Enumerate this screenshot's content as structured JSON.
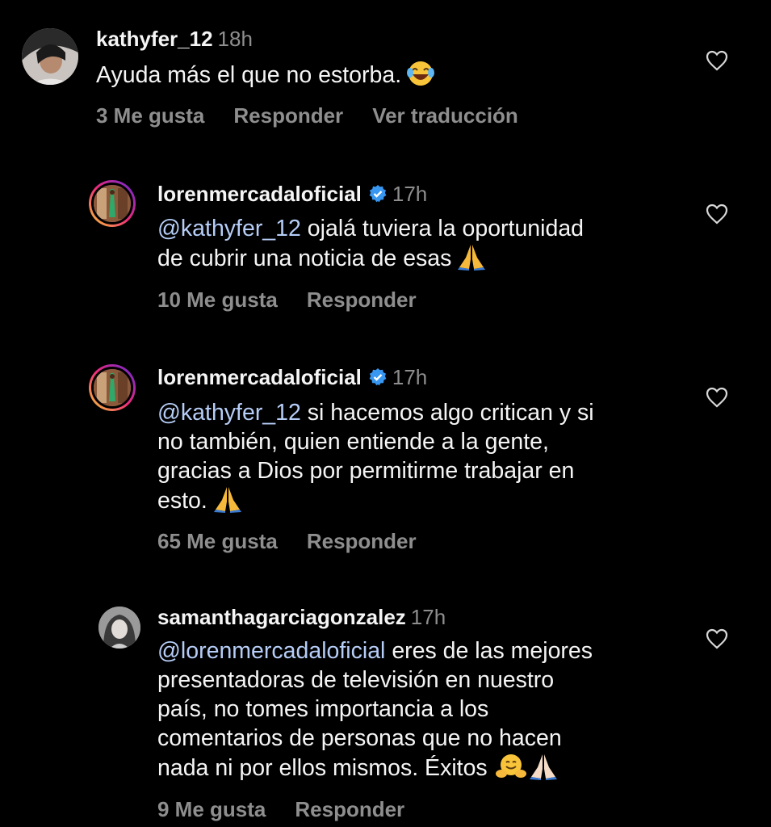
{
  "comments": [
    {
      "username": "kathyfer_12",
      "time": "18h",
      "text_pre": "Ayuda más el que no estorba.",
      "emoji": "laughing-tears-emoji",
      "likes": "3 Me gusta",
      "reply": "Responder",
      "translate": "Ver traducción"
    },
    {
      "username": "lorenmercadaloficial",
      "time": "17h",
      "verified": true,
      "mention": "@kathyfer_12",
      "text_line1": "ojalá tuviera la oportunidad",
      "text_line2": "de cubrir una noticia de esas",
      "emoji": "folded-hands-emoji",
      "likes": "10 Me gusta",
      "reply": "Responder"
    },
    {
      "username": "lorenmercadaloficial",
      "time": "17h",
      "verified": true,
      "mention": "@kathyfer_12",
      "text_line1": "si hacemos algo critican y si",
      "text_line2": "no también, quien entiende a la gente,",
      "text_line3": "gracias a Dios por permitirme trabajar en",
      "text_line4": "esto.",
      "emoji": "folded-hands-emoji",
      "likes": "65 Me gusta",
      "reply": "Responder"
    },
    {
      "username": "samanthagarciagonzalez",
      "time": "17h",
      "mention": "@lorenmercadaloficial",
      "text_line1": "eres de las mejores",
      "text_line2": "presentadoras de televisión en nuestro",
      "text_line3": "país, no tomes importancia a los",
      "text_line4": "comentarios de personas que no hacen",
      "text_line5": "nada ni por ellos mismos. Éxitos",
      "emoji": "hugging-face-emoji, folded-hands-emoji",
      "likes": "9 Me gusta",
      "reply": "Responder"
    }
  ],
  "colors": {
    "background": "#000000",
    "text": "#f5f5f5",
    "secondary": "#8e8e8e",
    "mention": "#b6cdf7",
    "verified": "#3897f0"
  }
}
